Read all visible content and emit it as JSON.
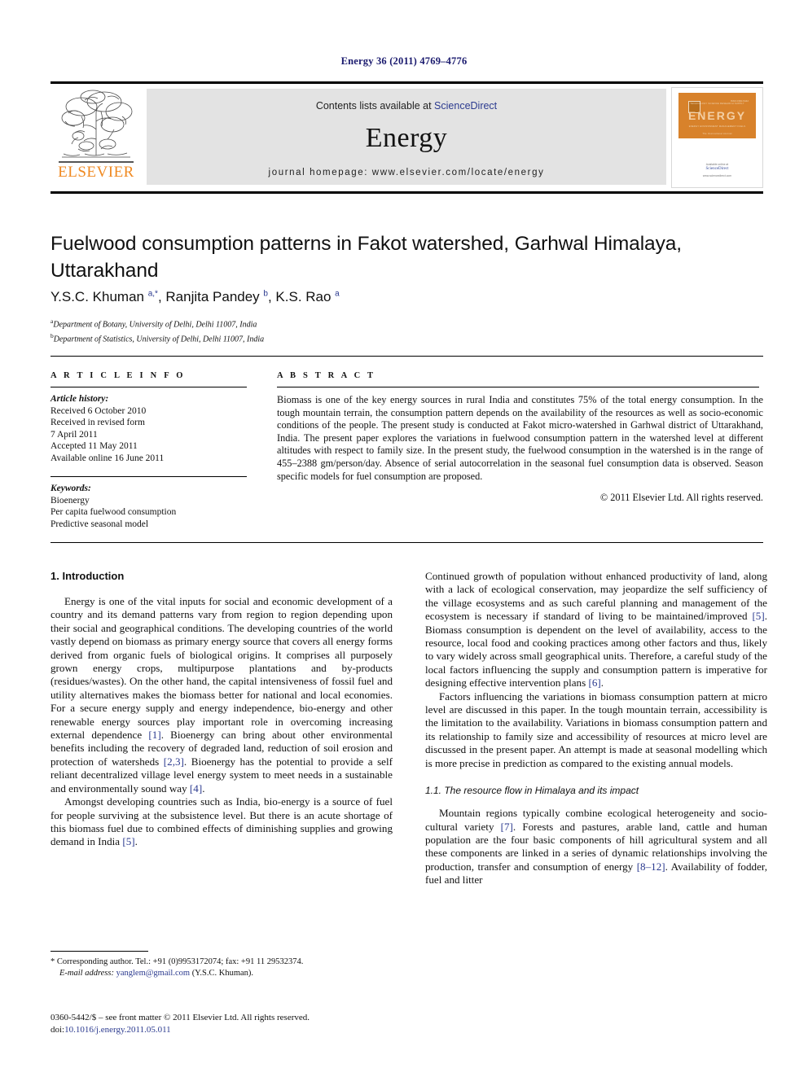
{
  "running_head": "Energy 36 (2011) 4769–4776",
  "masthead": {
    "contents_prefix": "Contents lists available at ",
    "sciencedirect": "ScienceDirect",
    "journal_name": "Energy",
    "homepage": "journal homepage: www.elsevier.com/locate/energy",
    "publisher_wordmark": "ELSEVIER",
    "publisher_logo_icon": "elsevier-tree-logo",
    "cover": {
      "title": "ENERGY",
      "issn": "ISSN 0360-5442",
      "row1": "TECHNOLOGY    SCIENCE    RESEARCH    SUPPLY",
      "row2": "ENERGY    ENVIRONMENT    MANAGEMENT    FUELS",
      "tagline": "The International Journal",
      "available_at": "Available online at",
      "sciencedirect": "ScienceDirect",
      "url": "www.sciencedirect.com"
    },
    "accent_blue": "#2b3a8f",
    "accent_orange": "#f08a22",
    "banner_gray": "#e3e3e3"
  },
  "article": {
    "title": "Fuelwood consumption patterns in Fakot watershed, Garhwal Himalaya, Uttarakhand",
    "authors_html": "Y.S.C. Khuman <sup>a,*</sup>, Ranjita Pandey <sup>b</sup>, K.S. Rao <sup>a</sup>",
    "affiliations": [
      {
        "marker": "a",
        "text": "Department of Botany, University of Delhi, Delhi 11007, India"
      },
      {
        "marker": "b",
        "text": "Department of Statistics, University of Delhi, Delhi 11007, India"
      }
    ]
  },
  "article_info": {
    "heading": "A R T I C L E   I N F O",
    "history_label": "Article history:",
    "history": [
      "Received 6 October 2010",
      "Received in revised form",
      "7 April 2011",
      "Accepted 11 May 2011",
      "Available online 16 June 2011"
    ],
    "keywords_label": "Keywords:",
    "keywords": [
      "Bioenergy",
      "Per capita fuelwood consumption",
      "Predictive seasonal model"
    ]
  },
  "abstract": {
    "heading": "A B S T R A C T",
    "text": "Biomass is one of the key energy sources in rural India and constitutes 75% of the total energy consumption. In the tough mountain terrain, the consumption pattern depends on the availability of the resources as well as socio-economic conditions of the people. The present study is conducted at Fakot micro-watershed in Garhwal district of Uttarakhand, India. The present paper explores the variations in fuelwood consumption pattern in the watershed level at different altitudes with respect to family size. In the present study, the fuelwood consumption in the watershed is in the range of 455–2388 gm/person/day. Absence of serial autocorrelation in the seasonal fuel consumption data is observed. Season specific models for fuel consumption are proposed.",
    "copyright": "© 2011 Elsevier Ltd. All rights reserved."
  },
  "body": {
    "section_heading": "1.  Introduction",
    "left_paragraphs": [
      "Energy is one of the vital inputs for social and economic development of a country and its demand patterns vary from region to region depending upon their social and geographical conditions. The developing countries of the world vastly depend on biomass as primary energy source that covers all energy forms derived from organic fuels of biological origins. It comprises all purposely grown energy crops, multipurpose plantations and by-products (residues/wastes). On the other hand, the capital intensiveness of fossil fuel and utility alternatives makes the biomass better for national and local economies. For a secure energy supply and energy independence, bio-energy and other renewable energy sources play important role in overcoming increasing external dependence [1]. Bioenergy can bring about other environmental benefits including the recovery of degraded land, reduction of soil erosion and protection of watersheds [2,3]. Bioenergy has the potential to provide a self reliant decentralized village level energy system to meet needs in a sustainable and environmentally sound way [4].",
      "Amongst developing countries such as India, bio-energy is a source of fuel for people surviving at the subsistence level. But there is an acute shortage of this biomass fuel due to combined effects of diminishing supplies and growing demand in India [5]."
    ],
    "right_paragraphs": [
      "Continued growth of population without enhanced productivity of land, along with a lack of ecological conservation, may jeopardize the self sufficiency of the village ecosystems and as such careful planning and management of the ecosystem is necessary if standard of living to be maintained/improved [5]. Biomass consumption is dependent on the level of availability, access to the resource, local food and cooking practices among other factors and thus, likely to vary widely across small geographical units. Therefore, a careful study of the local factors influencing the supply and consumption pattern is imperative for designing effective intervention plans [6].",
      "Factors influencing the variations in biomass consumption pattern at micro level are discussed in this paper. In the tough mountain terrain, accessibility is the limitation to the availability. Variations in biomass consumption pattern and its relationship to family size and accessibility of resources at micro level are discussed in the present paper. An attempt is made at seasonal modelling which is more precise in prediction as compared to the existing annual models."
    ],
    "subsection_heading": "1.1.  The resource flow in Himalaya and its impact",
    "subsection_paragraphs": [
      "Mountain regions typically combine ecological heterogeneity and socio-cultural variety [7]. Forests and pastures, arable land, cattle and human population are the four basic components of hill agricultural system and all these components are linked in a series of dynamic relationships involving the production, transfer and consumption of energy [8–12]. Availability of fodder, fuel and litter"
    ]
  },
  "footnotes": {
    "corresponding": "* Corresponding author. Tel.: +91 (0)9953172074; fax: +91 11 29532374.",
    "email_label": "E-mail address:",
    "email": "yanglem@gmail.com",
    "email_owner": "(Y.S.C. Khuman).",
    "imprint_line1": "0360-5442/$ – see front matter © 2011 Elsevier Ltd. All rights reserved.",
    "doi_label": "doi:",
    "doi": "10.1016/j.energy.2011.05.011"
  }
}
